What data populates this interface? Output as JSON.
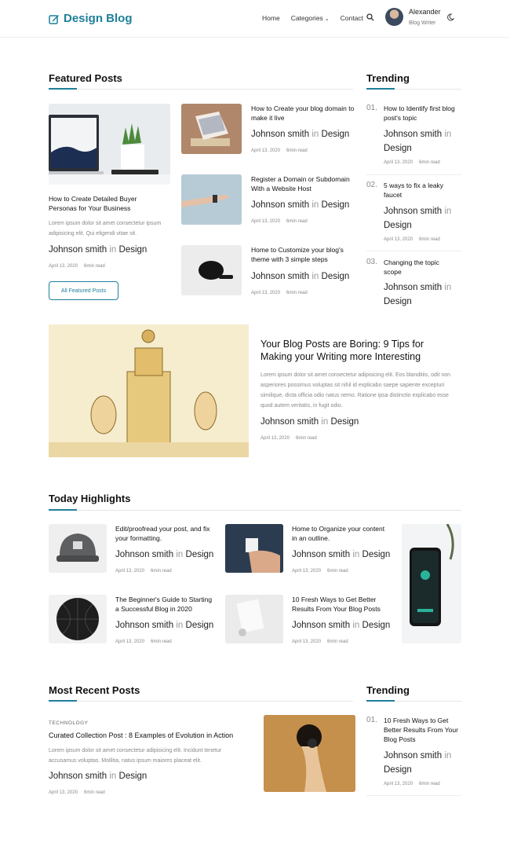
{
  "header": {
    "logo": "Design Blog",
    "nav": [
      "Home",
      "Categories",
      "Contact"
    ],
    "user_name": "Alexander",
    "user_role": "Blog Writer"
  },
  "author": {
    "name": "Johnson smith",
    "in": "in",
    "category": "Design"
  },
  "meta": {
    "date": "April 13, 2020",
    "read": "6min read"
  },
  "featured": {
    "title": "Featured Posts",
    "main": {
      "title": "How to Create Detailed Buyer Personas for Your Business",
      "excerpt": "Lorem ipsum dolor sit amet consectetur ipsum adipisicing elit. Qui eligendi vitae sit."
    },
    "button": "All Featured Posts",
    "items": [
      {
        "title": "How to Create your blog domain to make it live"
      },
      {
        "title": "Register a Domain or Subdomain With a Website Host"
      },
      {
        "title": "Home to Customize your blog's theme with 3 simple steps"
      }
    ]
  },
  "trending1": {
    "title": "Trending",
    "items": [
      {
        "num": "01.",
        "title": "How to Identify first blog post's topic"
      },
      {
        "num": "02.",
        "title": "5 ways to fix a leaky faucet"
      },
      {
        "num": "03.",
        "title": "Changing the topic scope"
      }
    ]
  },
  "banner": {
    "title": "Your Blog Posts are Boring: 9 Tips for Making your Writing more Interesting",
    "excerpt": "Lorem ipsum dolor sit amet consectetur adipisicing elit. Eos blanditiis, odit non asperiores possimus voluptas sit nihil id explicabo saepe sapiente excepturi similique, dicta officia odio natus nemo. Ratione ipsa distinctio explicabo esse quod autem veritatis, in fugit odio."
  },
  "highlights": {
    "title": "Today Highlights",
    "items": [
      {
        "title": "Edit/proofread your post, and fix your formatting."
      },
      {
        "title": "Home to Organize your content in an outline."
      },
      {
        "title": "The Beginner's Guide to Starting a Successful Blog in 2020"
      },
      {
        "title": "10 Fresh Ways to Get Better Results From Your Blog Posts"
      }
    ]
  },
  "recent": {
    "title": "Most Recent Posts",
    "category": "TECHNOLOGY",
    "post_title": "Curated Collection Post : 8 Examples of Evolution in Action",
    "excerpt": "Lorem ipsum dolor sit amet consectetur adipisicing elit. Incidunt tenetur accusamus voluptas. Mollitia, natus ipsum maiores placeat elit."
  },
  "trending2": {
    "title": "Trending",
    "items": [
      {
        "num": "01.",
        "title": "10 Fresh Ways to Get Better Results From Your Blog Posts"
      }
    ]
  },
  "colors": {
    "accent": "#1e7f9a"
  }
}
